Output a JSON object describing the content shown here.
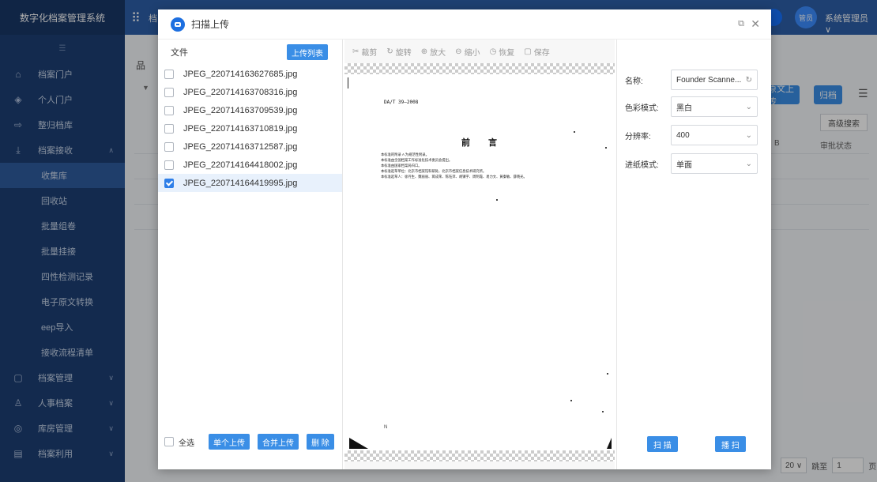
{
  "app": {
    "title": "数字化档案管理系统",
    "top_system_label": "档",
    "avatar_text": "管员",
    "user_name": "系统管理员 ∨"
  },
  "sidebar": {
    "items": [
      {
        "label": "档案门户",
        "icon": "home-icon",
        "glyph": "⌂"
      },
      {
        "label": "个人门户",
        "icon": "layers-icon",
        "glyph": "◈"
      },
      {
        "label": "整归档库",
        "icon": "transfer-icon",
        "glyph": "⇨"
      },
      {
        "label": "档案接收",
        "icon": "download-icon",
        "glyph": "⤓",
        "expanded": true
      }
    ],
    "subitems": [
      "收集库",
      "回收站",
      "批量组卷",
      "批量挂接",
      "四性检测记录",
      "电子原文转换",
      "eep导入",
      "接收流程清单"
    ],
    "bottom_items": [
      {
        "label": "档案管理",
        "icon": "folder-icon",
        "glyph": "▢"
      },
      {
        "label": "人事档案",
        "icon": "person-icon",
        "glyph": "♙"
      },
      {
        "label": "库房管理",
        "icon": "warehouse-icon",
        "glyph": "◎"
      },
      {
        "label": "档案利用",
        "icon": "document-icon",
        "glyph": "▤"
      }
    ]
  },
  "background": {
    "tree_icon": "品",
    "btn_upload_original": "原文上传",
    "btn_archive": "归档",
    "btn_advanced_search": "高级搜索",
    "col_review_status": "审批状态",
    "col_prefix": "B",
    "page_size": "20 ∨",
    "goto_label": "跳至",
    "goto_value": "1",
    "page_suffix": "页"
  },
  "dialog": {
    "title": "扫描上传",
    "files_label": "文件",
    "upload_list_button": "上传列表",
    "files": [
      {
        "name": "JPEG_220714163627685.jpg",
        "checked": false
      },
      {
        "name": "JPEG_220714163708316.jpg",
        "checked": false
      },
      {
        "name": "JPEG_220714163709539.jpg",
        "checked": false
      },
      {
        "name": "JPEG_220714163710819.jpg",
        "checked": false
      },
      {
        "name": "JPEG_220714163712587.jpg",
        "checked": false
      },
      {
        "name": "JPEG_220714164418002.jpg",
        "checked": false
      },
      {
        "name": "JPEG_220714164419995.jpg",
        "checked": true
      }
    ],
    "select_all_label": "全选",
    "single_upload_button": "单个上传",
    "merge_upload_button": "合并上传",
    "delete_button": "删 除",
    "toolbar": {
      "crop": "裁剪",
      "rotate": "旋转",
      "zoom_in": "放大",
      "zoom_out": "缩小",
      "restore": "恢复",
      "save": "保存"
    },
    "preview": {
      "doc_code": "DA/T 39—2008",
      "heading": "前　言",
      "lines": [
        "本标准的附录 A 为规范性附录。",
        "本标准由全国档案工作标准化技术委员会提出。",
        "本标准由国家档案局归口。",
        "本标准起草单位：北京市档案馆科研处、北京市档案信息技术研究所。",
        "本标准起草人：徐丹生、魏丽丽、蒋成荣、陈钰萍、胡镇宇、周明霞、易力文、黄秦敏、薛晓光。"
      ],
      "footer_mark": "N"
    },
    "form": {
      "name_label": "名称:",
      "name_value": "Founder Scanne...",
      "color_label": "色彩模式:",
      "color_value": "黑白",
      "resolution_label": "分辨率:",
      "resolution_value": "400",
      "paper_label": "进纸模式:",
      "paper_value": "单面"
    },
    "scan_button": "扫 描",
    "archive_button": "播 扫"
  }
}
